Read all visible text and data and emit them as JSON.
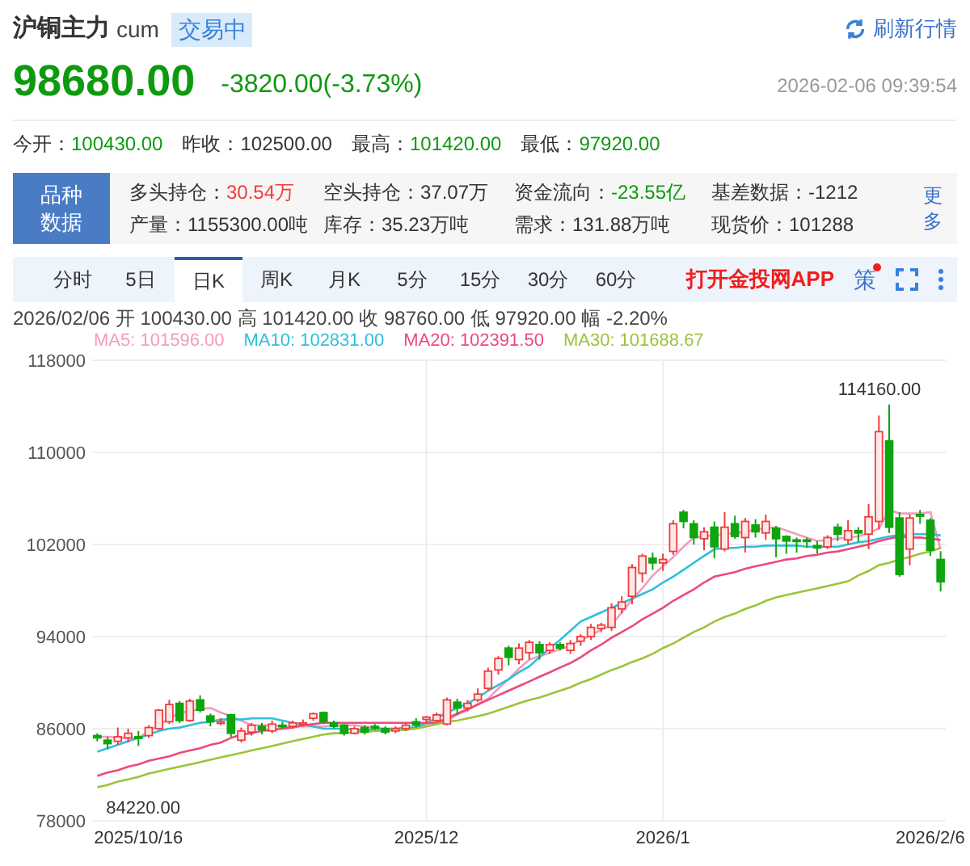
{
  "header": {
    "name": "沪铜主力",
    "code": "cum",
    "status": "交易中",
    "refresh": "刷新行情",
    "price": "98680.00",
    "change": "-3820.00(-3.73%)",
    "kind": "down",
    "time": "2026-02-06 09:39:54"
  },
  "quote_row": [
    {
      "label": "今开：",
      "value": "100430.00",
      "kind": "down"
    },
    {
      "label": "昨收：",
      "value": "102500.00",
      "kind": "flat"
    },
    {
      "label": "最高：",
      "value": "101420.00",
      "kind": "down"
    },
    {
      "label": "最低：",
      "value": "97920.00",
      "kind": "down"
    }
  ],
  "stats": {
    "title": "品种数据",
    "more": "更多",
    "items": [
      {
        "label": "多头持仓：",
        "value": "30.54万",
        "kind": "up"
      },
      {
        "label": "空头持仓：",
        "value": "37.07万",
        "kind": "flat"
      },
      {
        "label": "资金流向：",
        "value": "-23.55亿",
        "kind": "down"
      },
      {
        "label": "基差数据：",
        "value": "-1212",
        "kind": "flat"
      },
      {
        "label": "产量：",
        "value": "1155300.00吨",
        "kind": "flat"
      },
      {
        "label": "库存：",
        "value": "35.23万吨",
        "kind": "flat"
      },
      {
        "label": "需求：",
        "value": "131.88万吨",
        "kind": "flat"
      },
      {
        "label": "现货价：",
        "value": "101288",
        "kind": "flat"
      }
    ]
  },
  "tabs": [
    {
      "label": "分时",
      "selected": false
    },
    {
      "label": "5日",
      "selected": false
    },
    {
      "label": "日K",
      "selected": true
    },
    {
      "label": "周K",
      "selected": false
    },
    {
      "label": "月K",
      "selected": false
    },
    {
      "label": "5分",
      "selected": false
    },
    {
      "label": "15分",
      "selected": false
    },
    {
      "label": "30分",
      "selected": false
    },
    {
      "label": "60分",
      "selected": false
    }
  ],
  "app_link": "打开金投网APP",
  "strategy": {
    "label": "策",
    "badge": true
  },
  "bar_info": "2026/02/06 开 100430.00 高 101420.00 收 98760.00 低 97920.00 幅 -2.20%",
  "chart_data": {
    "type": "candlestick",
    "grid": true,
    "ylim": [
      78000,
      118000
    ],
    "yticks": [
      78000,
      86000,
      94000,
      102000,
      110000,
      118000
    ],
    "categories": [
      null,
      null,
      null,
      null,
      "2025/10/16",
      null,
      null,
      null,
      null,
      null,
      null,
      null,
      null,
      null,
      null,
      null,
      null,
      null,
      null,
      null,
      null,
      null,
      null,
      null,
      null,
      null,
      null,
      null,
      null,
      null,
      null,
      null,
      "2025/12",
      null,
      null,
      null,
      null,
      null,
      null,
      null,
      null,
      null,
      null,
      null,
      null,
      null,
      null,
      null,
      null,
      null,
      null,
      null,
      null,
      null,
      null,
      "2026/1",
      null,
      null,
      null,
      null,
      null,
      null,
      null,
      null,
      null,
      null,
      null,
      null,
      null,
      null,
      null,
      null,
      null,
      null,
      null,
      null,
      null,
      null,
      null,
      null,
      null,
      "2026/2/6",
      null
    ],
    "annotations": [
      "114160.00",
      "84220.00"
    ],
    "series": [
      {
        "ohlc": [
          [
            85400,
            85600,
            84900,
            85200
          ],
          [
            85000,
            85300,
            84220,
            84700
          ],
          [
            84900,
            86100,
            84600,
            85300
          ],
          [
            85200,
            86000,
            84800,
            85600
          ],
          [
            85300,
            85800,
            84500,
            85200
          ],
          [
            85400,
            86300,
            85200,
            86100
          ],
          [
            86000,
            87700,
            85900,
            87600
          ],
          [
            86600,
            88500,
            86400,
            88100
          ],
          [
            88200,
            88400,
            86500,
            86700
          ],
          [
            86700,
            88600,
            86600,
            88400
          ],
          [
            88500,
            88900,
            87400,
            87600
          ],
          [
            87100,
            87300,
            86200,
            86600
          ],
          [
            86500,
            86900,
            86300,
            86600
          ],
          [
            87200,
            87300,
            85300,
            85600
          ],
          [
            85000,
            86100,
            84800,
            85800
          ],
          [
            85700,
            86500,
            85400,
            86300
          ],
          [
            86200,
            86500,
            85500,
            85900
          ],
          [
            85800,
            86700,
            85600,
            86400
          ],
          [
            86300,
            86600,
            86000,
            86200
          ],
          [
            86200,
            86700,
            86000,
            86500
          ],
          [
            86400,
            86800,
            86200,
            86500
          ],
          [
            86900,
            87400,
            86700,
            87300
          ],
          [
            87400,
            87500,
            86400,
            86600
          ],
          [
            86500,
            86700,
            86000,
            86200
          ],
          [
            86300,
            86400,
            85400,
            85600
          ],
          [
            85600,
            86200,
            85500,
            86000
          ],
          [
            86100,
            86300,
            85500,
            85700
          ],
          [
            86200,
            86400,
            85900,
            86100
          ],
          [
            86000,
            86200,
            85500,
            85700
          ],
          [
            85800,
            86200,
            85600,
            86000
          ],
          [
            86000,
            86500,
            85800,
            86300
          ],
          [
            86600,
            86900,
            86100,
            86300
          ],
          [
            86800,
            87100,
            86400,
            87000
          ],
          [
            86700,
            87400,
            86500,
            87200
          ],
          [
            86400,
            88700,
            86300,
            88500
          ],
          [
            88300,
            88600,
            87200,
            87800
          ],
          [
            87800,
            88500,
            87500,
            88200
          ],
          [
            88500,
            89500,
            88300,
            89000
          ],
          [
            89500,
            91300,
            89300,
            91000
          ],
          [
            91100,
            92300,
            90700,
            92100
          ],
          [
            93000,
            93200,
            91500,
            92200
          ],
          [
            92000,
            93400,
            91600,
            93000
          ],
          [
            92600,
            93700,
            92000,
            93500
          ],
          [
            93300,
            93600,
            92000,
            92600
          ],
          [
            92800,
            93500,
            92500,
            93300
          ],
          [
            93300,
            93500,
            92800,
            93000
          ],
          [
            92800,
            93700,
            92500,
            93400
          ],
          [
            93600,
            94200,
            93200,
            94000
          ],
          [
            94000,
            95100,
            93700,
            94800
          ],
          [
            94700,
            95200,
            94400,
            95000
          ],
          [
            94800,
            96900,
            94500,
            96500
          ],
          [
            96400,
            97500,
            96000,
            97000
          ],
          [
            97500,
            100300,
            96800,
            100000
          ],
          [
            99500,
            101200,
            98700,
            101000
          ],
          [
            100800,
            101300,
            99800,
            100400
          ],
          [
            100400,
            101200,
            99700,
            100700
          ],
          [
            101400,
            104100,
            101100,
            103800
          ],
          [
            104800,
            105000,
            103400,
            104000
          ],
          [
            103800,
            104100,
            102000,
            102600
          ],
          [
            102500,
            103500,
            101500,
            103100
          ],
          [
            103500,
            104000,
            100800,
            101800
          ],
          [
            101600,
            104800,
            101400,
            103500
          ],
          [
            103800,
            104500,
            102500,
            102700
          ],
          [
            102600,
            104300,
            101300,
            104000
          ],
          [
            103700,
            104200,
            102600,
            103100
          ],
          [
            103000,
            104600,
            102400,
            104000
          ],
          [
            103400,
            103600,
            100900,
            102500
          ],
          [
            102700,
            102800,
            101200,
            102300
          ],
          [
            102400,
            102600,
            101300,
            102300
          ],
          [
            102400,
            102600,
            101700,
            102300
          ],
          [
            101900,
            102300,
            101200,
            101700
          ],
          [
            101800,
            102800,
            101600,
            102600
          ],
          [
            103500,
            103800,
            102300,
            102900
          ],
          [
            102400,
            104100,
            102000,
            103200
          ],
          [
            103200,
            103500,
            102200,
            103000
          ],
          [
            102900,
            105500,
            101600,
            104400
          ],
          [
            104000,
            113200,
            103300,
            111800
          ],
          [
            111000,
            114160,
            103000,
            103500
          ],
          [
            104300,
            104800,
            99200,
            99400
          ],
          [
            101600,
            104600,
            100200,
            104300
          ],
          [
            104600,
            105000,
            103800,
            104500
          ],
          [
            104100,
            104300,
            101000,
            101500
          ],
          [
            100700,
            101420,
            97920,
            98760
          ]
        ]
      },
      {
        "name": "MA5: 101596.00",
        "type": "line",
        "color": "#f59bbd",
        "values": [
          85300,
          85300,
          85200,
          85200,
          85200,
          85800,
          86300,
          86900,
          87400,
          87500,
          87700,
          87800,
          87400,
          87100,
          86700,
          86300,
          86300,
          86300,
          86200,
          86200,
          86200,
          86200,
          86200,
          86300,
          86300,
          86300,
          86200,
          86100,
          86000,
          86000,
          85900,
          86100,
          86300,
          86500,
          86700,
          87200,
          87600,
          88100,
          88600,
          89500,
          90300,
          91200,
          92000,
          92300,
          92600,
          92900,
          93200,
          93700,
          94100,
          94600,
          95000,
          96100,
          97200,
          98200,
          99300,
          100100,
          100900,
          101800,
          102600,
          102700,
          102800,
          102900,
          103000,
          103100,
          103300,
          103400,
          103500,
          103200,
          102900,
          102600,
          102300,
          102400,
          102500,
          102600,
          102700,
          103000,
          103400,
          105000,
          104700,
          104700,
          104700,
          104800,
          101600
        ]
      },
      {
        "name": "MA10: 102831.00",
        "type": "line",
        "color": "#2fbfdc",
        "values": [
          84000,
          84300,
          84600,
          84900,
          85200,
          85500,
          85800,
          86000,
          86100,
          86300,
          86500,
          86600,
          86800,
          86800,
          86800,
          86900,
          86900,
          86900,
          86700,
          86500,
          86400,
          86200,
          86000,
          86000,
          86000,
          85900,
          85900,
          85900,
          86000,
          86000,
          86100,
          86100,
          86500,
          86900,
          87400,
          87800,
          88200,
          88700,
          89300,
          89800,
          90300,
          90900,
          91400,
          92200,
          93000,
          93700,
          94500,
          95300,
          95700,
          96100,
          96500,
          96900,
          97300,
          97700,
          98100,
          98700,
          99200,
          99800,
          100400,
          101000,
          101600,
          101700,
          101700,
          101800,
          101800,
          101900,
          101900,
          101900,
          101900,
          101800,
          101800,
          101800,
          101800,
          102000,
          102200,
          102300,
          102500,
          102700,
          102800,
          102900,
          102900,
          102900,
          102800
        ]
      },
      {
        "name": "MA20: 102391.50",
        "type": "line",
        "color": "#ec4a7c",
        "values": [
          81900,
          82200,
          82400,
          82700,
          82900,
          83200,
          83400,
          83600,
          83900,
          84100,
          84300,
          84600,
          84800,
          85200,
          85500,
          85600,
          85800,
          85900,
          86000,
          86100,
          86300,
          86400,
          86500,
          86500,
          86500,
          86500,
          86500,
          86500,
          86500,
          86500,
          86500,
          86500,
          86500,
          86500,
          86900,
          87300,
          87700,
          88100,
          88500,
          88900,
          89300,
          89700,
          90100,
          90500,
          90900,
          91300,
          91700,
          92200,
          92800,
          93300,
          93900,
          94400,
          94900,
          95500,
          96000,
          96500,
          97100,
          97600,
          98100,
          98700,
          99200,
          99400,
          99600,
          99900,
          100100,
          100300,
          100500,
          100700,
          100800,
          101000,
          101100,
          101300,
          101400,
          101600,
          101800,
          102000,
          102300,
          102500,
          102700,
          102600,
          102600,
          102500,
          102400
        ]
      },
      {
        "name": "MA30: 101688.67",
        "type": "line",
        "color": "#9cc43a",
        "values": [
          80900,
          81100,
          81400,
          81600,
          81800,
          82100,
          82300,
          82500,
          82700,
          82900,
          83100,
          83300,
          83500,
          83700,
          83900,
          84100,
          84300,
          84500,
          84700,
          84900,
          85100,
          85300,
          85500,
          85600,
          85600,
          85700,
          85700,
          85800,
          85800,
          85900,
          85900,
          86000,
          86200,
          86400,
          86600,
          86700,
          86900,
          87100,
          87300,
          87600,
          87900,
          88200,
          88500,
          88700,
          89000,
          89300,
          89600,
          90000,
          90300,
          90700,
          91100,
          91400,
          91800,
          92100,
          92500,
          93000,
          93400,
          93900,
          94400,
          94800,
          95300,
          95700,
          96000,
          96400,
          96700,
          97100,
          97400,
          97600,
          97800,
          98000,
          98200,
          98400,
          98600,
          98800,
          99300,
          99700,
          100200,
          100400,
          100700,
          100900,
          101200,
          101400,
          101700
        ]
      }
    ]
  }
}
